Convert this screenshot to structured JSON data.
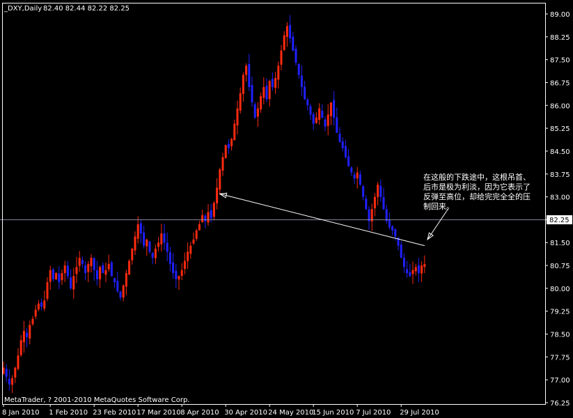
{
  "header": {
    "symbol": "_DXY,Daily",
    "ohlc": "82.40 82.44 82.22 82.25"
  },
  "copyright": "MetaTrader, ? 2001-2010 MetaQuotes Software Corp.",
  "annotation": {
    "lines": [
      "在这般的下跌途中，这根吊首、",
      "后市是极为利淡，因为它表示了",
      "反弹至高位，却给完完全全的压",
      "制回来。"
    ]
  },
  "colors": {
    "background": "#000000",
    "up_candle": "#ff2a10",
    "down_candle": "#2020ff",
    "doji": "#22cc22",
    "price_line": "#8a8aa8",
    "axis": "#ffffff"
  },
  "chart_data": {
    "type": "candlestick",
    "timeframe": "Daily",
    "current_price": 82.25,
    "y_ticks": [
      89.0,
      88.25,
      87.5,
      86.75,
      86.0,
      85.25,
      84.5,
      83.75,
      83.0,
      82.25,
      81.5,
      80.75,
      80.0,
      79.25,
      78.5,
      77.75,
      77.0,
      76.25
    ],
    "y_tick_labels": [
      "89.00",
      "88.25",
      "87.50",
      "86.75",
      "86.00",
      "85.25",
      "84.50",
      "83.75",
      "83.00",
      "82.25",
      "81.50",
      "80.75",
      "80.00",
      "79.25",
      "78.50",
      "77.75",
      "77.00",
      "76.25"
    ],
    "ylim": [
      76.25,
      89.3
    ],
    "x_labels": [
      "8 Jan 2010",
      "1 Feb 2010",
      "23 Feb 2010",
      "17 Mar 2010",
      "8 Apr 2010",
      "30 Apr 2010",
      "24 May 2010",
      "15 Jun 2010",
      "7 Jul 2010",
      "29 Jul 2010"
    ],
    "x_label_index": [
      0,
      16,
      31,
      46,
      61,
      76,
      91,
      106,
      121,
      136
    ],
    "close_path": [
      [
        0,
        77.4
      ],
      [
        1,
        77.1
      ],
      [
        2,
        76.85
      ],
      [
        3,
        77.05
      ],
      [
        4,
        77.4
      ],
      [
        5,
        77.8
      ],
      [
        6,
        78.3
      ],
      [
        7,
        78.6
      ],
      [
        8,
        78.4
      ],
      [
        9,
        78.8
      ],
      [
        10,
        79.0
      ],
      [
        11,
        79.3
      ],
      [
        12,
        79.5
      ],
      [
        13,
        79.4
      ],
      [
        14,
        79.6
      ],
      [
        15,
        80.2
      ],
      [
        16,
        80.6
      ],
      [
        17,
        80.3
      ],
      [
        18,
        80.5
      ],
      [
        19,
        80.2
      ],
      [
        20,
        80.5
      ],
      [
        21,
        80.75
      ],
      [
        22,
        80.4
      ],
      [
        23,
        80.0
      ],
      [
        24,
        80.4
      ],
      [
        25,
        80.7
      ],
      [
        26,
        81.0
      ],
      [
        27,
        80.8
      ],
      [
        28,
        80.5
      ],
      [
        29,
        80.8
      ],
      [
        30,
        81.0
      ],
      [
        31,
        80.6
      ],
      [
        32,
        80.3
      ],
      [
        33,
        80.7
      ],
      [
        34,
        80.5
      ],
      [
        35,
        80.6
      ],
      [
        36,
        80.8
      ],
      [
        37,
        80.4
      ],
      [
        38,
        80.2
      ],
      [
        39,
        79.9
      ],
      [
        40,
        79.7
      ],
      [
        41,
        80.1
      ],
      [
        42,
        80.5
      ],
      [
        43,
        80.9
      ],
      [
        44,
        81.3
      ],
      [
        45,
        81.7
      ],
      [
        46,
        82.1
      ],
      [
        47,
        81.8
      ],
      [
        48,
        81.4
      ],
      [
        49,
        81.6
      ],
      [
        50,
        81.2
      ],
      [
        51,
        81.0
      ],
      [
        52,
        81.3
      ],
      [
        53,
        81.5
      ],
      [
        54,
        81.8
      ],
      [
        55,
        81.5
      ],
      [
        56,
        81.2
      ],
      [
        57,
        80.8
      ],
      [
        58,
        80.5
      ],
      [
        59,
        80.3
      ],
      [
        60,
        80.4
      ],
      [
        61,
        80.6
      ],
      [
        62,
        80.9
      ],
      [
        63,
        81.2
      ],
      [
        64,
        81.4
      ],
      [
        65,
        81.6
      ],
      [
        66,
        81.9
      ],
      [
        67,
        82.1
      ],
      [
        68,
        82.4
      ],
      [
        69,
        82.2
      ],
      [
        70,
        82.5
      ],
      [
        71,
        82.3
      ],
      [
        72,
        82.8
      ],
      [
        73,
        83.3
      ],
      [
        74,
        83.9
      ],
      [
        75,
        84.3
      ],
      [
        76,
        84.7
      ],
      [
        77,
        84.6
      ],
      [
        78,
        84.9
      ],
      [
        79,
        85.4
      ],
      [
        80,
        85.9
      ],
      [
        81,
        86.4
      ],
      [
        82,
        87.0
      ],
      [
        83,
        87.3
      ],
      [
        84,
        86.6
      ],
      [
        85,
        86.1
      ],
      [
        86,
        85.6
      ],
      [
        87,
        85.9
      ],
      [
        88,
        86.3
      ],
      [
        89,
        86.6
      ],
      [
        90,
        86.2
      ],
      [
        91,
        86.8
      ],
      [
        92,
        86.6
      ],
      [
        93,
        86.9
      ],
      [
        94,
        87.3
      ],
      [
        95,
        87.8
      ],
      [
        96,
        88.3
      ],
      [
        97,
        88.6
      ],
      [
        98,
        88.2
      ],
      [
        99,
        87.8
      ],
      [
        100,
        87.4
      ],
      [
        101,
        87.0
      ],
      [
        102,
        86.6
      ],
      [
        103,
        86.2
      ],
      [
        104,
        86.0
      ],
      [
        105,
        85.7
      ],
      [
        106,
        85.4
      ],
      [
        107,
        85.6
      ],
      [
        108,
        85.9
      ],
      [
        109,
        85.6
      ],
      [
        110,
        85.3
      ],
      [
        111,
        85.7
      ],
      [
        112,
        86.1
      ],
      [
        113,
        85.6
      ],
      [
        114,
        85.1
      ],
      [
        115,
        84.8
      ],
      [
        116,
        84.6
      ],
      [
        117,
        84.3
      ],
      [
        118,
        84.0
      ],
      [
        119,
        83.8
      ],
      [
        120,
        83.6
      ],
      [
        121,
        83.8
      ],
      [
        122,
        83.4
      ],
      [
        123,
        83.0
      ],
      [
        124,
        82.6
      ],
      [
        125,
        82.2
      ],
      [
        126,
        82.6
      ],
      [
        127,
        83.0
      ],
      [
        128,
        83.4
      ],
      [
        129,
        83.0
      ],
      [
        130,
        82.6
      ],
      [
        131,
        82.2
      ],
      [
        132,
        82.0
      ],
      [
        133,
        81.9
      ],
      [
        134,
        81.7
      ],
      [
        135,
        81.4
      ],
      [
        136,
        81.0
      ],
      [
        137,
        80.7
      ],
      [
        138,
        80.5
      ],
      [
        139,
        80.4
      ],
      [
        140,
        80.6
      ],
      [
        141,
        80.7
      ],
      [
        142,
        80.5
      ],
      [
        143,
        80.75
      ],
      [
        144,
        80.8
      ]
    ],
    "arrows": [
      {
        "from": [
          144,
          81.4
        ],
        "to": [
          74,
          83.1
        ]
      },
      {
        "from": [
          152,
          82.6
        ],
        "to": [
          145,
          81.6
        ]
      }
    ]
  }
}
